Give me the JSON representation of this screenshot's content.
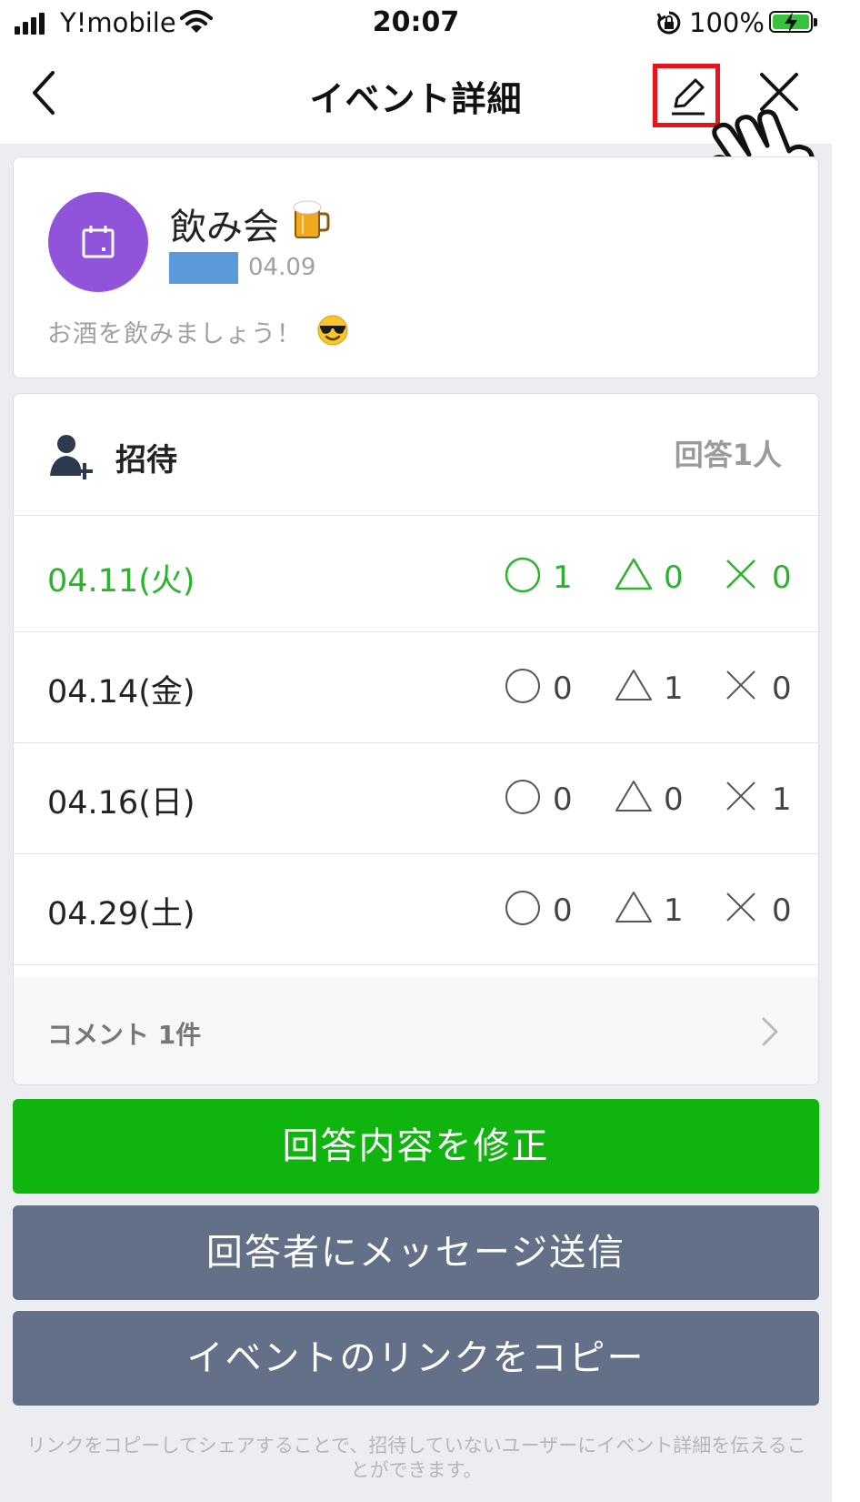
{
  "status_bar": {
    "carrier": "Y!mobile",
    "time": "20:07",
    "battery": "100%"
  },
  "nav": {
    "title": "イベント詳細",
    "icons": [
      "back-chevron-icon",
      "pencil-icon",
      "close-icon"
    ]
  },
  "event": {
    "title": "飲み会",
    "date": "04.09",
    "description": "お酒を飲みましょう！",
    "avatar_color": "#9253db"
  },
  "invite": {
    "label": "招待",
    "responses": "回答1人",
    "rows": [
      {
        "date": "04.11(火)",
        "yes": "1",
        "maybe": "0",
        "no": "0",
        "highlight": true
      },
      {
        "date": "04.14(金)",
        "yes": "0",
        "maybe": "1",
        "no": "0",
        "highlight": false
      },
      {
        "date": "04.16(日)",
        "yes": "0",
        "maybe": "0",
        "no": "1",
        "highlight": false
      },
      {
        "date": "04.29(土)",
        "yes": "0",
        "maybe": "1",
        "no": "0",
        "highlight": false
      }
    ],
    "comments": "コメント 1件"
  },
  "buttons": {
    "edit_answer": "回答内容を修正",
    "message_respondents": "回答者にメッセージ送信",
    "copy_link": "イベントのリンクをコピー"
  },
  "footnote": "リンクをコピーしてシェアすることで、招待していないユーザーにイベント詳細を伝えることができます。",
  "colors": {
    "accent_green": "#0fb40f",
    "button_gray": "#637087",
    "highlight_red": "#e8141b"
  }
}
